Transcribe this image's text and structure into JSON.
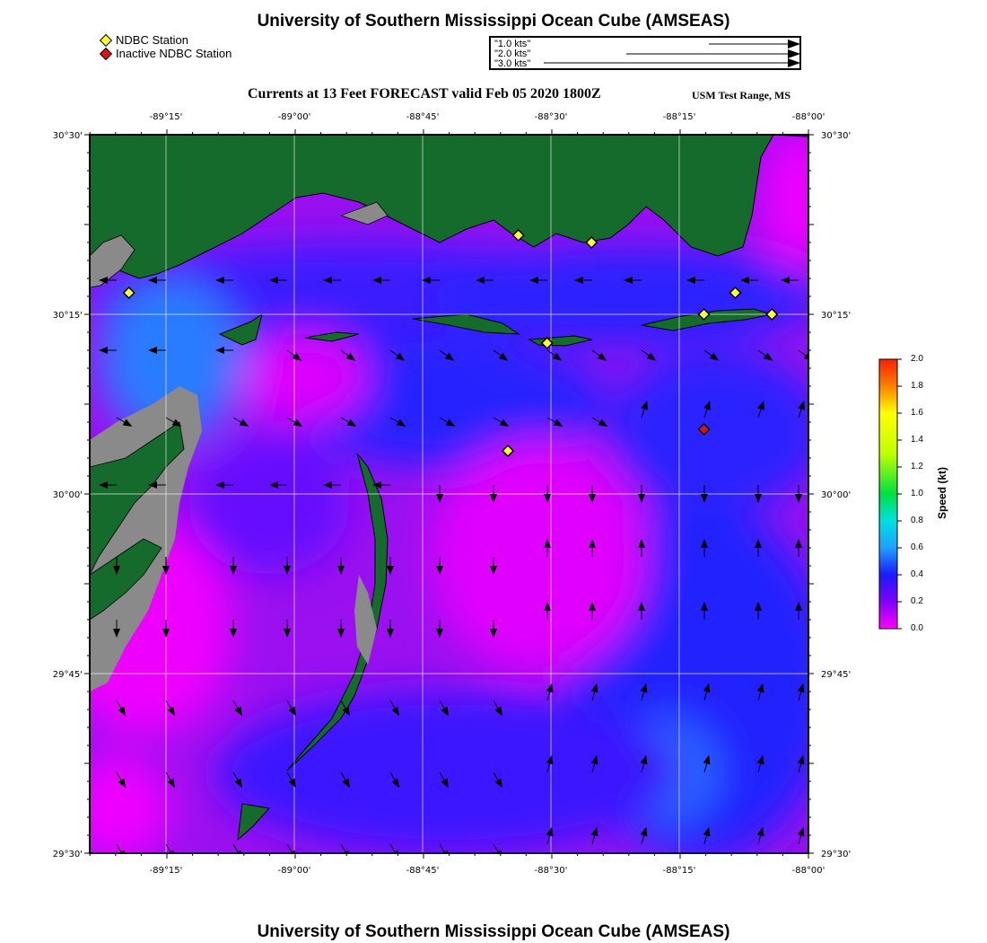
{
  "header": {
    "title": "University of Southern Mississippi Ocean Cube (AMSEAS)",
    "subtitle": "Currents at 13 Feet FORECAST valid Feb 05 2020 1800Z",
    "region": "USM Test Range, MS"
  },
  "legend": {
    "active_station": "NDBC Station",
    "inactive_station": "Inactive NDBC Station",
    "active_color": "#ffff33",
    "inactive_color": "#dd1111"
  },
  "scale_arrows": [
    {
      "label": "1.0 kts"
    },
    {
      "label": "2.0 kts"
    },
    {
      "label": "3.0 kts"
    }
  ],
  "axes": {
    "top_ticks": [
      "-89°15'",
      "-89°00'",
      "-88°45'",
      "-88°30'",
      "-88°15'",
      "-88°00'"
    ],
    "bottom_ticks": [
      "-89°15'",
      "-89°00'",
      "-88°45'",
      "-88°30'",
      "-88°15'",
      "-88°00'"
    ],
    "left_ticks": [
      "30°30'",
      "30°15'",
      "30°00'",
      "29°45'",
      "29°30'"
    ],
    "right_ticks": [
      "30°30'",
      "30°15'",
      "30°00'",
      "29°45'",
      "29°30'"
    ],
    "lon_range": [
      -89.375,
      -88.0
    ],
    "lat_range": [
      29.5,
      30.5
    ]
  },
  "colorbar": {
    "title": "Speed (kt)",
    "ticks": [
      "2.0",
      "1.8",
      "1.6",
      "1.4",
      "1.2",
      "1.0",
      "0.8",
      "0.6",
      "0.4",
      "0.2",
      "0.0"
    ],
    "colors": [
      "#ff00ff",
      "#1a1aff",
      "#1fa0ff",
      "#00e0c0",
      "#00e020",
      "#c0ff00",
      "#ffff00",
      "#ff8000",
      "#ff2000"
    ]
  },
  "stations": [
    {
      "lon": -89.3,
      "lat": 30.28,
      "active": true
    },
    {
      "lon": -88.555,
      "lat": 30.36,
      "active": true
    },
    {
      "lon": -88.415,
      "lat": 30.35,
      "active": true
    },
    {
      "lon": -88.2,
      "lat": 30.25,
      "active": true
    },
    {
      "lon": -88.14,
      "lat": 30.28,
      "active": true
    },
    {
      "lon": -88.07,
      "lat": 30.25,
      "active": true
    },
    {
      "lon": -88.5,
      "lat": 30.21,
      "active": true
    },
    {
      "lon": -88.575,
      "lat": 30.06,
      "active": true
    },
    {
      "lon": -88.2,
      "lat": 30.09,
      "active": false
    }
  ],
  "footer": {
    "title": "University of Southern Mississippi Ocean Cube (AMSEAS)"
  }
}
